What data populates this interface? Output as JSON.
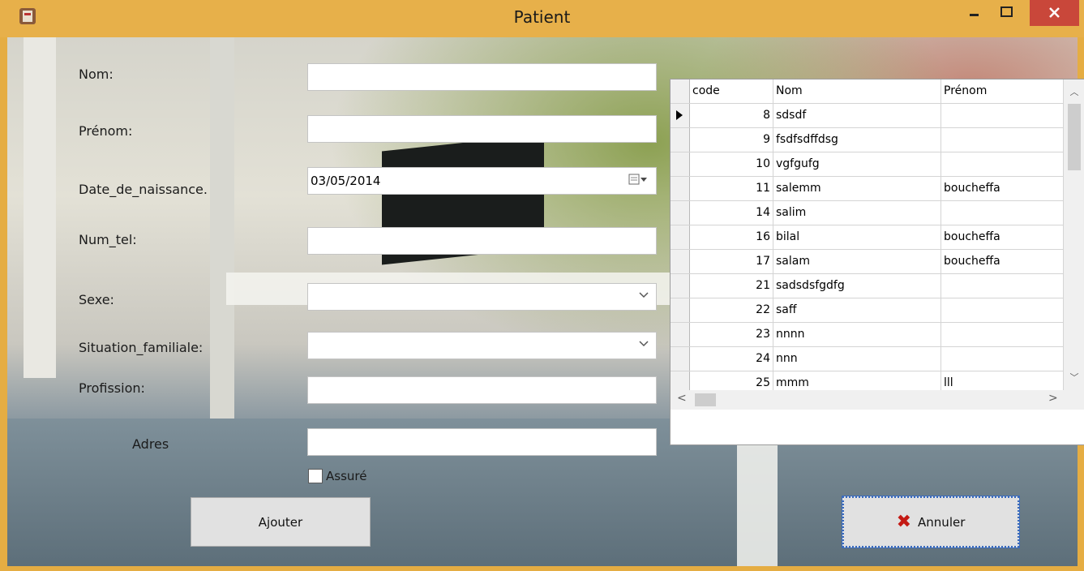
{
  "window": {
    "title": "Patient",
    "accent_color": "#e7b04a",
    "close_color": "#c9473a"
  },
  "form": {
    "nom_label": "Nom:",
    "prenom_label": "Prénom:",
    "date_label": "Date_de_naissance.",
    "date_value": "03/05/2014",
    "tel_label": "Num_tel:",
    "sexe_label": "Sexe:",
    "situation_label": "Situation_familiale:",
    "profession_label": "Profission:",
    "adresse_label": "Adres",
    "assure_label": "Assuré",
    "assure_checked": false
  },
  "buttons": {
    "ajouter": "Ajouter",
    "annuler": "Annuler"
  },
  "grid": {
    "columns": [
      "code",
      "Nom",
      "Prénom"
    ],
    "rows": [
      {
        "code": "8",
        "nom": "sdsdf",
        "prenom": ""
      },
      {
        "code": "9",
        "nom": "fsdfsdffdsg",
        "prenom": ""
      },
      {
        "code": "10",
        "nom": "vgfgufg",
        "prenom": ""
      },
      {
        "code": "11",
        "nom": "salemm",
        "prenom": "boucheffa"
      },
      {
        "code": "14",
        "nom": "salim",
        "prenom": ""
      },
      {
        "code": "16",
        "nom": "bilal",
        "prenom": "boucheffa"
      },
      {
        "code": "17",
        "nom": "salam",
        "prenom": "boucheffa"
      },
      {
        "code": "21",
        "nom": "sadsdsfgdfg",
        "prenom": ""
      },
      {
        "code": "22",
        "nom": "saff",
        "prenom": ""
      },
      {
        "code": "23",
        "nom": "nnnn",
        "prenom": ""
      },
      {
        "code": "24",
        "nom": "nnn",
        "prenom": ""
      },
      {
        "code": "25",
        "nom": "mmm",
        "prenom": "lll"
      }
    ]
  },
  "icons": {
    "app": "app-icon",
    "minimize": "minimize-icon",
    "maximize": "maximize-icon",
    "close": "close-icon",
    "calendar": "calendar-icon",
    "dropdown": "chevron-down-icon",
    "annuler": "x-icon"
  }
}
